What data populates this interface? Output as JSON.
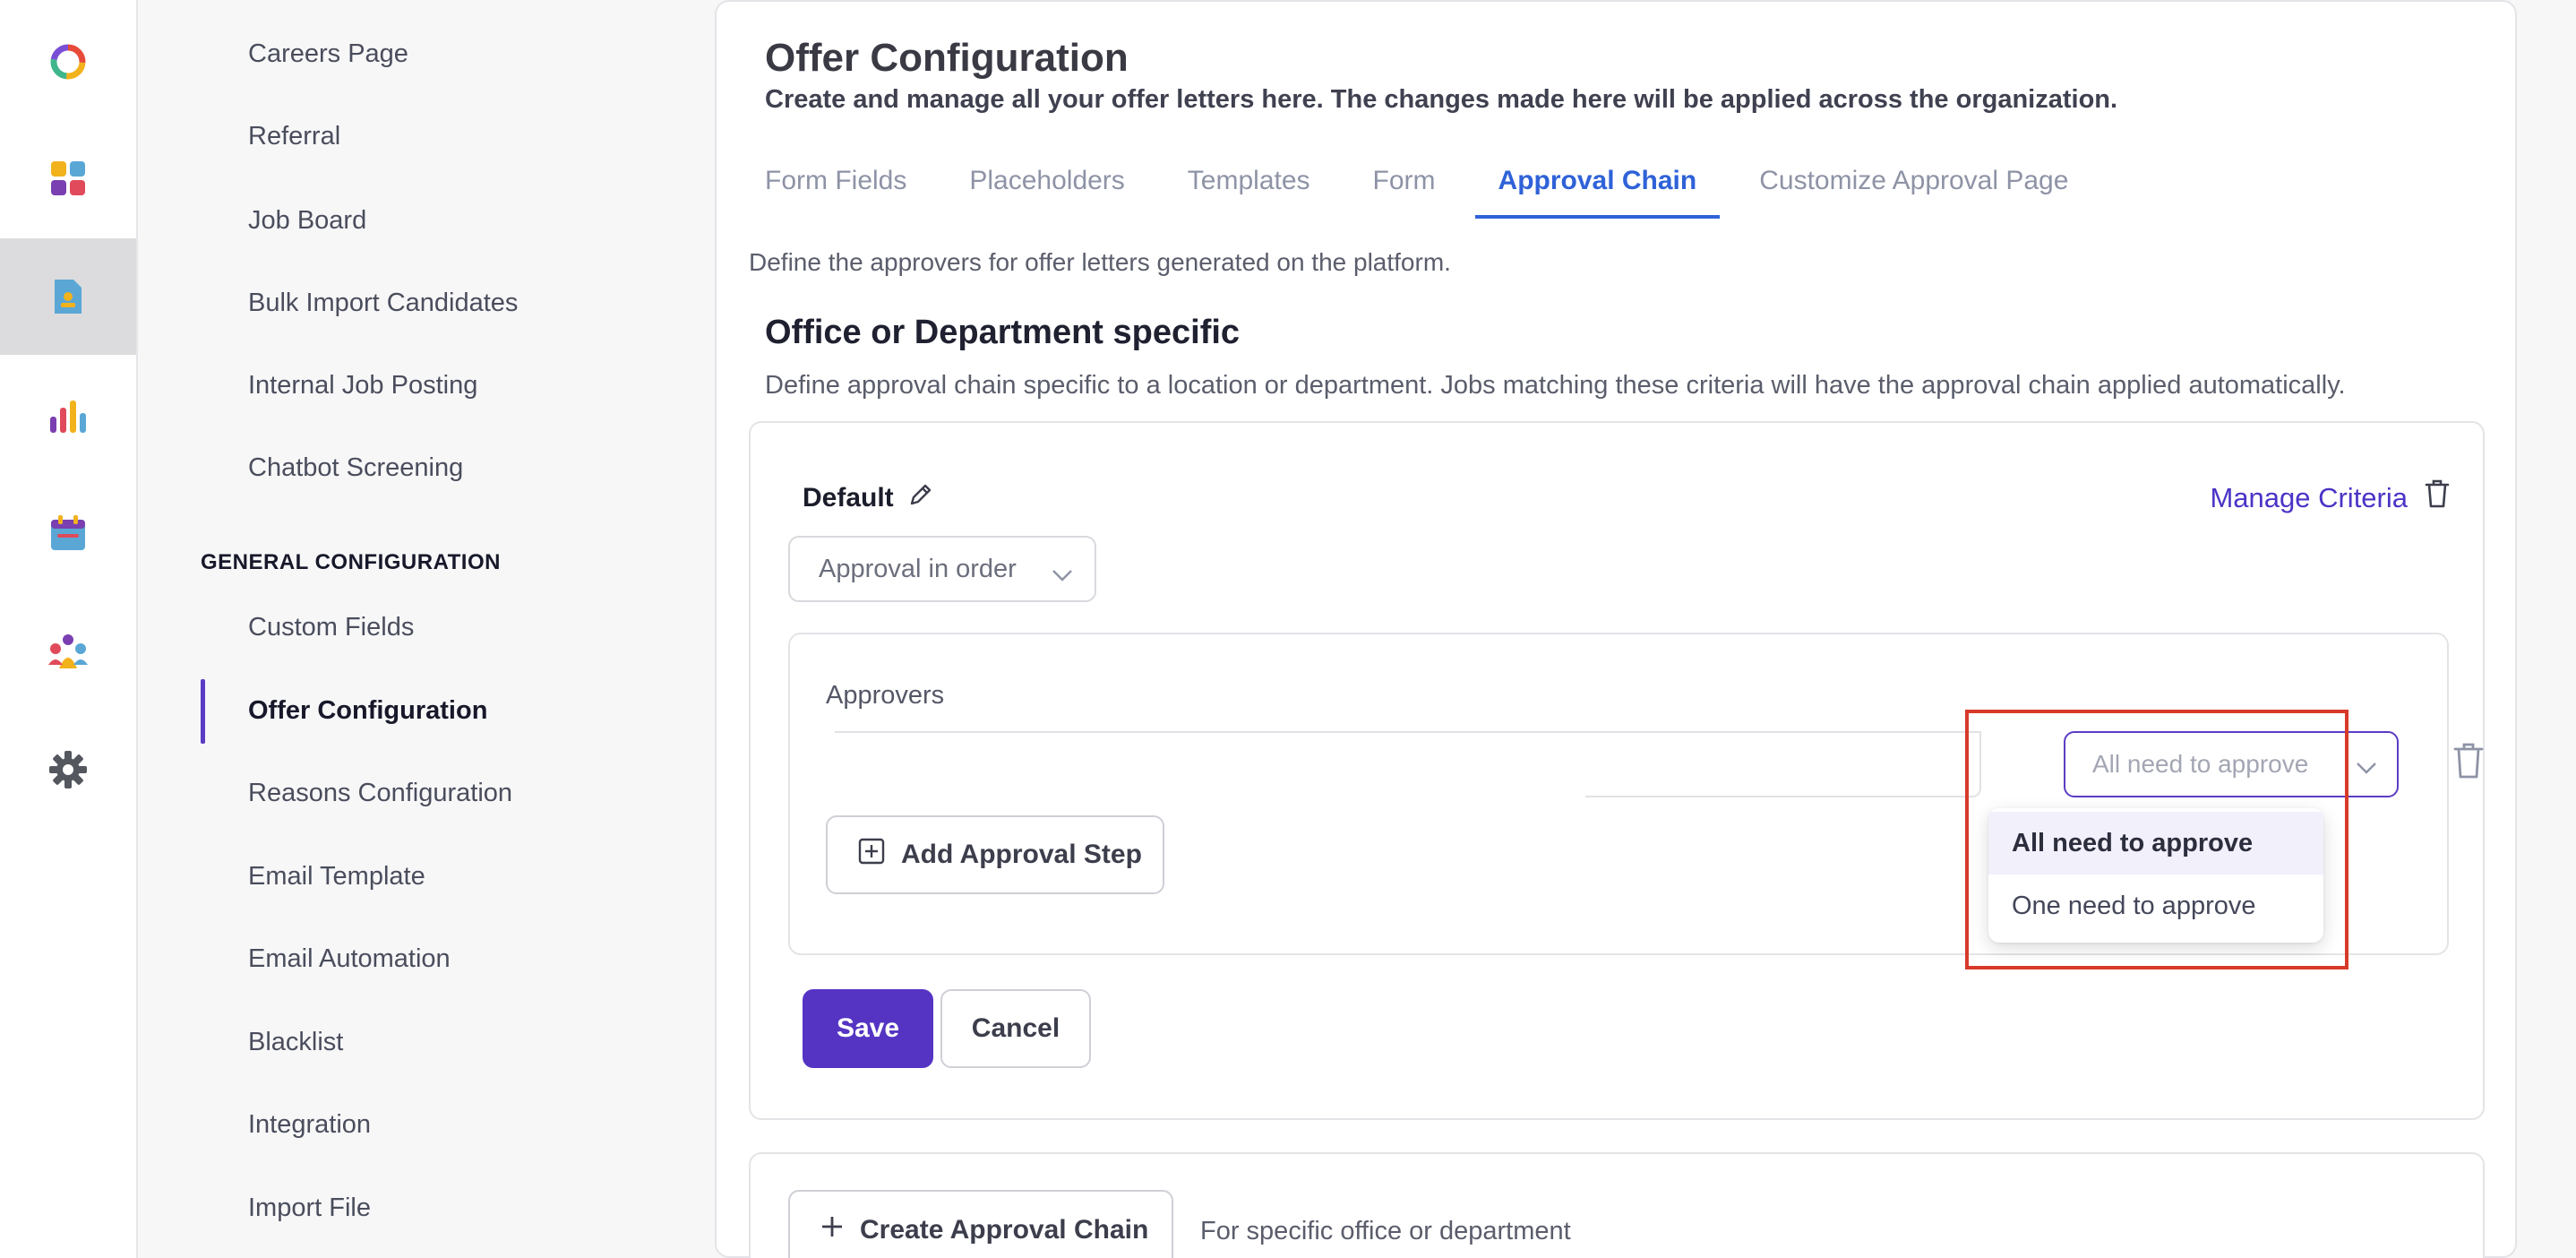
{
  "rail": {
    "items": [
      {
        "icon": "logo-ring-icon"
      },
      {
        "icon": "apps-grid-icon"
      },
      {
        "icon": "document-icon",
        "active": true
      },
      {
        "icon": "bar-chart-icon"
      },
      {
        "icon": "calendar-icon"
      },
      {
        "icon": "team-icon"
      },
      {
        "icon": "gear-icon"
      }
    ]
  },
  "sidebar": {
    "items_top": [
      "Careers Page",
      "Referral",
      "Job Board",
      "Bulk Import Candidates",
      "Internal Job Posting",
      "Chatbot Screening"
    ],
    "section_title": "GENERAL CONFIGURATION",
    "items_general": [
      "Custom Fields",
      "Offer Configuration",
      "Reasons Configuration",
      "Email Template",
      "Email Automation",
      "Blacklist",
      "Integration",
      "Import File"
    ],
    "active_item": "Offer Configuration"
  },
  "main": {
    "title": "Offer Configuration",
    "subtitle": "Create and manage all your offer letters here. The changes made here will be applied across the organization.",
    "tabs": [
      {
        "label": "Form Fields"
      },
      {
        "label": "Placeholders"
      },
      {
        "label": "Templates"
      },
      {
        "label": "Form"
      },
      {
        "label": "Approval Chain",
        "active": true
      },
      {
        "label": "Customize Approval Page"
      }
    ],
    "define_text": "Define the approvers for offer letters generated on the platform.",
    "section_title": "Office or Department specific",
    "section_desc": "Define approval chain specific to a location or department. Jobs matching these criteria will have the approval chain applied automatically.",
    "chain": {
      "name": "Default",
      "manage_criteria": "Manage Criteria",
      "order_select": "Approval in order",
      "approvers_label": "Approvers",
      "mode_select_placeholder": "All need to approve",
      "add_step": "Add Approval Step",
      "dropdown_options": [
        "All need to approve",
        "One need to approve"
      ],
      "dropdown_selected": "All need to approve",
      "save": "Save",
      "cancel": "Cancel"
    },
    "create": {
      "button": "Create Approval Chain",
      "desc": "For specific office or department"
    }
  },
  "colors": {
    "accent": "#5534c4",
    "tab_active": "#2f62d8",
    "link": "#4a34c6",
    "highlight": "#d83a2a"
  }
}
